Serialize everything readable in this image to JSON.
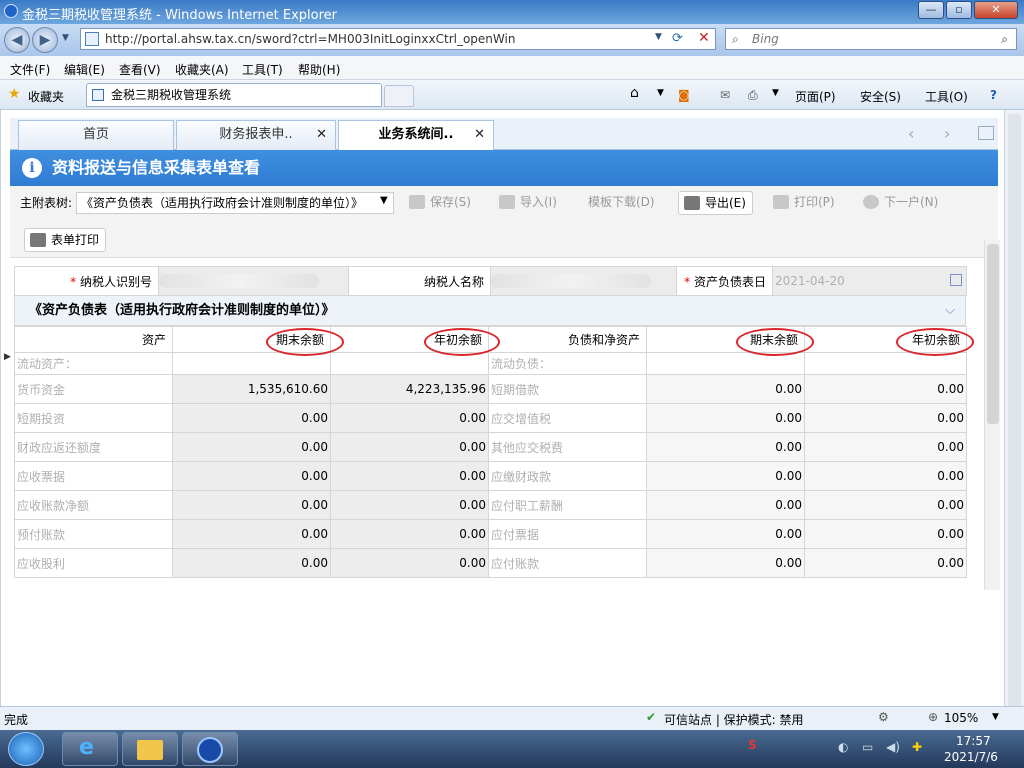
{
  "window": {
    "title": "金税三期税收管理系统 - Windows Internet Explorer",
    "min": "—",
    "max": "▫",
    "close": "✕"
  },
  "address": {
    "url": "http://portal.ahsw.tax.cn/sword?ctrl=MH003InitLoginxxCtrl_openWin",
    "search_placeholder": "Bing"
  },
  "menu": [
    "文件(F)",
    "编辑(E)",
    "查看(V)",
    "收藏夹(A)",
    "工具(T)",
    "帮助(H)"
  ],
  "favorites": {
    "label": "收藏夹",
    "tab_title": "金税三期税收管理系统"
  },
  "ie_toolbar": {
    "page": "页面(P)",
    "safety": "安全(S)",
    "tools": "工具(O)"
  },
  "app_tabs": [
    {
      "label": "首页",
      "closable": false
    },
    {
      "label": "财务报表申..",
      "closable": true
    },
    {
      "label": "业务系统间..",
      "closable": true,
      "active": true
    }
  ],
  "header": {
    "title": "资料报送与信息采集表单查看"
  },
  "toolbar": {
    "main_label": "主附表树:",
    "selected_table": "《资产负债表（适用执行政府会计准则制度的单位）》",
    "save": "保存(S)",
    "import": "导入(I)",
    "template": "模板下载(D)",
    "export": "导出(E)",
    "print": "打印(P)",
    "next": "下一户(N)",
    "form_print": "表单打印"
  },
  "info": {
    "taxpayer_id_label": "纳税人识别号",
    "taxpayer_name_label": "纳税人名称",
    "report_date_label": "资产负债表日",
    "report_date": "2021-04-20"
  },
  "form_title": "《资产负债表（适用执行政府会计准则制度的单位）》",
  "columns": {
    "assets": "资产",
    "end_balance": "期末余额",
    "begin_balance": "年初余额",
    "liabilities": "负债和净资产"
  },
  "section": {
    "assets": "流动资产：",
    "liabilities": "流动负债："
  },
  "rows": [
    {
      "asset": "货币资金",
      "asset_end": "1,535,610.60",
      "asset_begin": "4,223,135.96",
      "liab": "短期借款",
      "liab_end": "0.00",
      "liab_begin": "0.00"
    },
    {
      "asset": "短期投资",
      "asset_end": "0.00",
      "asset_begin": "0.00",
      "liab": "应交增值税",
      "liab_end": "0.00",
      "liab_begin": "0.00"
    },
    {
      "asset": "财政应返还额度",
      "asset_end": "0.00",
      "asset_begin": "0.00",
      "liab": "其他应交税费",
      "liab_end": "0.00",
      "liab_begin": "0.00"
    },
    {
      "asset": "应收票据",
      "asset_end": "0.00",
      "asset_begin": "0.00",
      "liab": "应缴财政款",
      "liab_end": "0.00",
      "liab_begin": "0.00"
    },
    {
      "asset": "应收账款净额",
      "asset_end": "0.00",
      "asset_begin": "0.00",
      "liab": "应付职工薪酬",
      "liab_end": "0.00",
      "liab_begin": "0.00"
    },
    {
      "asset": "预付账款",
      "asset_end": "0.00",
      "asset_begin": "0.00",
      "liab": "应付票据",
      "liab_end": "0.00",
      "liab_begin": "0.00"
    },
    {
      "asset": "应收股利",
      "asset_end": "0.00",
      "asset_begin": "0.00",
      "liab": "应付账款",
      "liab_end": "0.00",
      "liab_begin": "0.00"
    }
  ],
  "status": {
    "left": "完成",
    "zone": "可信站点 | 保护模式: 禁用",
    "zoom": "105%"
  },
  "clock": {
    "time": "17:57",
    "date": "2021/7/6"
  }
}
